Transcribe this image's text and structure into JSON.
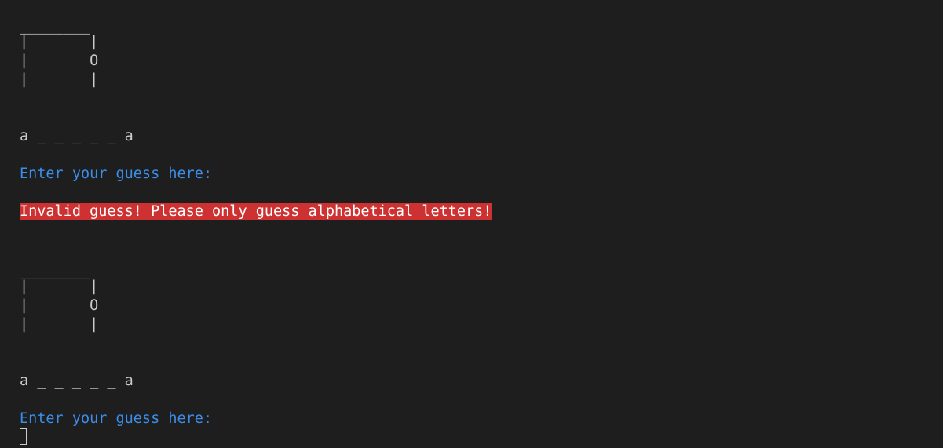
{
  "terminal": {
    "blocks": [
      {
        "gallows": [
          "________",
          "|       |",
          "|       O",
          "|       |"
        ],
        "word": "a _ _ _ _ _ a",
        "prompt": "Enter your guess here:"
      },
      {
        "gallows": [
          "________",
          "|       |",
          "|       O",
          "|       |"
        ],
        "word": "a _ _ _ _ _ a",
        "prompt": "Enter your guess here:"
      }
    ],
    "error_message": "Invalid guess! Please only guess alphabetical letters!"
  },
  "colors": {
    "background": "#1e1e1e",
    "text": "#cccccc",
    "prompt": "#3b8eea",
    "error_background": "#cd3131",
    "error_text": "#ffffff"
  }
}
